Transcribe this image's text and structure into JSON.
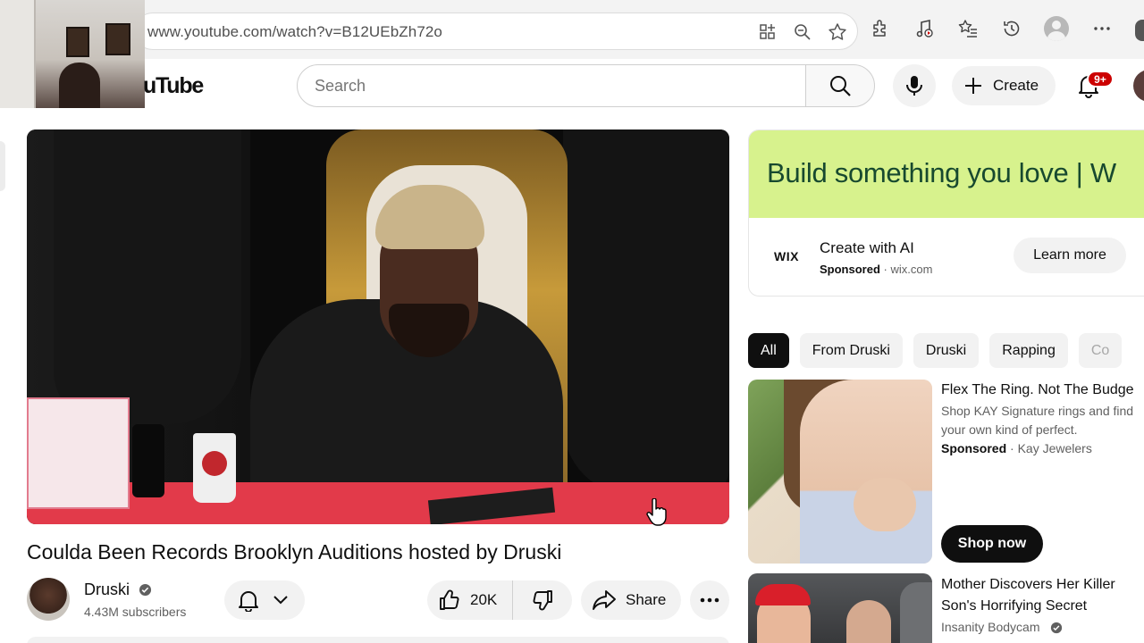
{
  "browser": {
    "url": "www.youtube.com/watch?v=B12UEbZh72o"
  },
  "yt_header": {
    "logo_text": "uTube",
    "search_placeholder": "Search",
    "create_label": "Create",
    "notification_badge": "9+"
  },
  "video": {
    "title": "Coulda Been Records Brooklyn Auditions hosted by Druski",
    "channel_name": "Druski",
    "subscribers": "4.43M subscribers",
    "likes": "20K",
    "share_label": "Share"
  },
  "ad": {
    "banner_text": "Build something you love | W",
    "logo_text": "WIX",
    "title": "Create with AI",
    "sponsored": "Sponsored",
    "domain": " · wix.com",
    "cta": "Learn more"
  },
  "chips": [
    "All",
    "From Druski",
    "Druski",
    "Rapping",
    "Co"
  ],
  "recommendations": {
    "promo": {
      "title": "Flex The Ring. Not The Budge",
      "description": "Shop KAY Signature rings and find your own kind of perfect.",
      "sponsored": "Sponsored",
      "advertiser": " · Kay Jewelers",
      "cta": "Shop now"
    },
    "next": {
      "title": "Mother Discovers Her Killer Son's Horrifying Secret",
      "channel": "Insanity Bodycam"
    }
  },
  "colors": {
    "badge_red": "#cc0000",
    "ad_banner_green": "#d7f28d",
    "ad_banner_text": "#17492f",
    "chip_active": "#0f0f0f"
  }
}
